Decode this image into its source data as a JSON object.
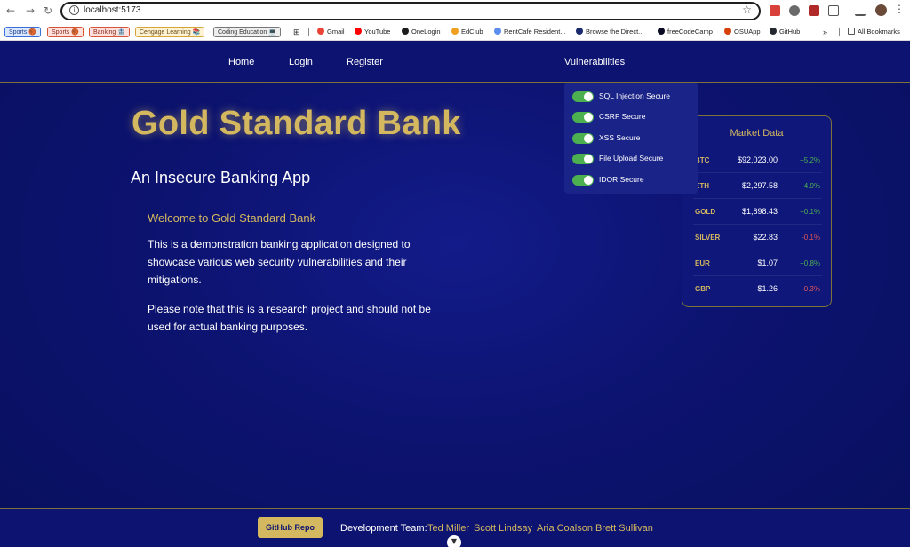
{
  "browser": {
    "url": "localhost:5173",
    "bookmark_chips": [
      {
        "label": "Sports 🏀",
        "bg": "#dbe7ff",
        "border": "#3a6fd8",
        "color": "#1a3f8f"
      },
      {
        "label": "Sports 🏀",
        "bg": "#ffe0dc",
        "border": "#d8553a",
        "color": "#8f2a1a"
      },
      {
        "label": "Banking 🏦",
        "bg": "#ffe0dc",
        "border": "#d8553a",
        "color": "#8f2a1a"
      },
      {
        "label": "Cengage Learning 📚",
        "bg": "#fff3d6",
        "border": "#d8a53a",
        "color": "#6a4b10"
      },
      {
        "label": "Coding Education 💻",
        "bg": "#eeeeee",
        "border": "#777777",
        "color": "#333333"
      }
    ],
    "bookmarks": [
      {
        "label": "Gmail",
        "icon": "gmail-icon",
        "color": "#ea4335"
      },
      {
        "label": "YouTube",
        "icon": "youtube-icon",
        "color": "#ff0000"
      },
      {
        "label": "OneLogin",
        "icon": "onelogin-icon",
        "color": "#1c1c1c"
      },
      {
        "label": "EdClub",
        "icon": "edclub-icon",
        "color": "#f0a020"
      },
      {
        "label": "RentCafe Resident...",
        "icon": "rentcafe-icon",
        "color": "#5b8def"
      },
      {
        "label": "Browse the Direct...",
        "icon": "directory-icon",
        "color": "#1a2a6c"
      },
      {
        "label": "freeCodeCamp",
        "icon": "freecodecamp-icon",
        "color": "#0a0a23"
      },
      {
        "label": "OSUApp",
        "icon": "osuapp-icon",
        "color": "#d73f09"
      },
      {
        "label": "GitHub",
        "icon": "github-icon",
        "color": "#24292f"
      }
    ],
    "all_bookmarks": "All Bookmarks"
  },
  "nav": {
    "home": "Home",
    "login": "Login",
    "register": "Register",
    "vulnerabilities": "Vulnerabilities"
  },
  "dropdown": {
    "items": [
      {
        "label": "SQL Injection Secure",
        "enabled": true
      },
      {
        "label": "CSRF Secure",
        "enabled": true
      },
      {
        "label": "XSS Secure",
        "enabled": true
      },
      {
        "label": "File Upload Secure",
        "enabled": true
      },
      {
        "label": "IDOR Secure",
        "enabled": true
      }
    ]
  },
  "hero": {
    "title": "Gold Standard Bank",
    "subtitle": "An Insecure Banking App",
    "welcome": "Welcome to Gold Standard Bank",
    "para1": "This is a demonstration banking application designed to showcase various web security vulnerabilities and their mitigations.",
    "para2": "Please note that this is a research project and should not be used for actual banking purposes."
  },
  "market": {
    "title": "Market Data",
    "rows": [
      {
        "symbol": "BTC",
        "price": "$92,023.00",
        "change": "+5.2%",
        "direction": "up"
      },
      {
        "symbol": "ETH",
        "price": "$2,297.58",
        "change": "+4.9%",
        "direction": "up"
      },
      {
        "symbol": "GOLD",
        "price": "$1,898.43",
        "change": "+0.1%",
        "direction": "up"
      },
      {
        "symbol": "SILVER",
        "price": "$22.83",
        "change": "-0.1%",
        "direction": "down"
      },
      {
        "symbol": "EUR",
        "price": "$1.07",
        "change": "+0.8%",
        "direction": "up"
      },
      {
        "symbol": "GBP",
        "price": "$1.26",
        "change": "-0.3%",
        "direction": "down"
      }
    ]
  },
  "footer": {
    "github_button": "GitHub Repo",
    "team_label": "Development Team:",
    "members": [
      "Ted Miller",
      "Scott Lindsay",
      "Aria Coalson",
      "Brett Sullivan"
    ]
  },
  "colors": {
    "gold": "#d4b860",
    "background": "#0c1370",
    "up": "#4caf50",
    "down": "#e05555"
  }
}
